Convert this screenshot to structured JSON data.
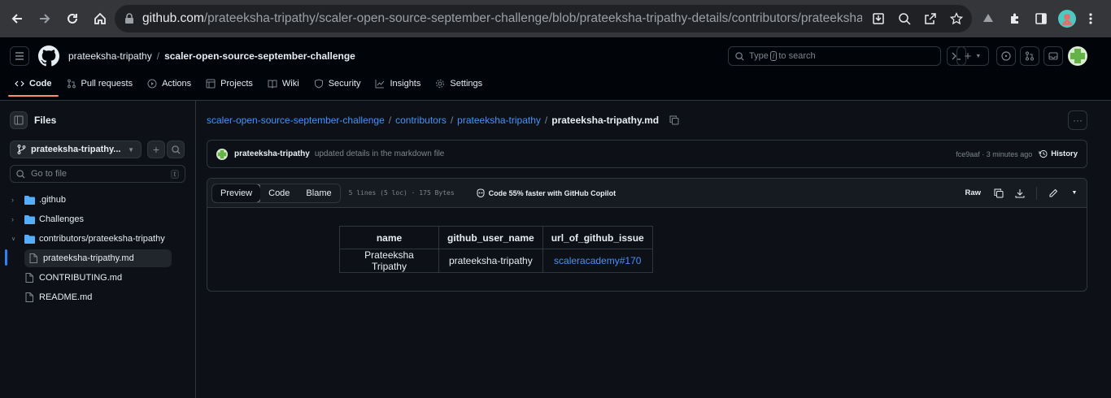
{
  "browser": {
    "url_domain": "github.com",
    "url_path": "/prateeksha-tripathy/scaler-open-source-september-challenge/blob/prateeksha-tripathy-details/contributors/prateeksha-tripathy/..."
  },
  "header": {
    "owner": "prateeksha-tripathy",
    "separator": "/",
    "repo": "scaler-open-source-september-challenge",
    "search_prefix": "Type",
    "search_key": "/",
    "search_suffix": "to search",
    "plus_label": "+"
  },
  "tabs": [
    {
      "label": "Code",
      "icon": "code-icon"
    },
    {
      "label": "Pull requests",
      "icon": "pull-request-icon"
    },
    {
      "label": "Actions",
      "icon": "play-icon"
    },
    {
      "label": "Projects",
      "icon": "table-icon"
    },
    {
      "label": "Wiki",
      "icon": "book-icon"
    },
    {
      "label": "Security",
      "icon": "shield-icon"
    },
    {
      "label": "Insights",
      "icon": "graph-icon"
    },
    {
      "label": "Settings",
      "icon": "gear-icon"
    }
  ],
  "sidebar": {
    "title": "Files",
    "branch": "prateeksha-tripathy...",
    "goto_placeholder": "Go to file",
    "goto_shortcut": "t",
    "tree": [
      {
        "label": ".github",
        "type": "folder",
        "expanded": false
      },
      {
        "label": "Challenges",
        "type": "folder",
        "expanded": false
      },
      {
        "label": "contributors/prateeksha-tripathy",
        "type": "folder",
        "expanded": true
      },
      {
        "label": "prateeksha-tripathy.md",
        "type": "file",
        "selected": true
      },
      {
        "label": "CONTRIBUTING.md",
        "type": "file"
      },
      {
        "label": "README.md",
        "type": "file"
      }
    ]
  },
  "breadcrumb": {
    "repo": "scaler-open-source-september-challenge",
    "dir1": "contributors",
    "dir2": "prateeksha-tripathy",
    "file": "prateeksha-tripathy.md",
    "sep": "/",
    "more": "···"
  },
  "commit": {
    "author": "prateeksha-tripathy",
    "message": "updated details in the markdown file",
    "meta": "fce9aaf · 3 minutes ago",
    "history": "History"
  },
  "file": {
    "view_tabs": [
      "Preview",
      "Code",
      "Blame"
    ],
    "info": "5 lines (5 loc) · 175 Bytes",
    "copilot": "Code 55% faster with GitHub Copilot",
    "raw": "Raw"
  },
  "table": {
    "headers": [
      "name",
      "github_user_name",
      "url_of_github_issue"
    ],
    "row": [
      "Prateeksha Tripathy",
      "prateeksha-tripathy",
      "scaleracademy#170"
    ]
  },
  "colors": {
    "bg": "#0d1117",
    "header_bg": "#010409",
    "link": "#4493f8",
    "active_tab": "#fd8c73",
    "border": "#30363d"
  }
}
